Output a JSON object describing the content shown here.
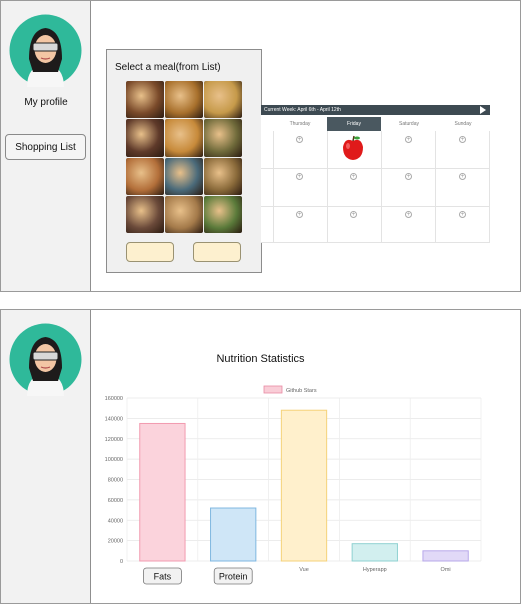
{
  "top": {
    "sidebar": {
      "profile_label": "My profile",
      "shopping_list_label": "Shopping List"
    },
    "dialog": {
      "title": "Select a meal(from List)",
      "tiles": [
        "#7a4a2a",
        "#a8702c",
        "#c69a4a",
        "#5f3a2a",
        "#c78a3a",
        "#6f6a3a",
        "#b36f3a",
        "#4a6a7a",
        "#8a6a3a",
        "#6b4a3a",
        "#a47a4a",
        "#5a7a3a"
      ]
    },
    "calendar": {
      "header": "Current Week: April 6th - April 12th",
      "days": [
        "Thursday",
        "Friday",
        "Saturday",
        "Sunday"
      ],
      "active_day": "Friday"
    }
  },
  "bottom": {
    "chart_title": "Nutrition Statistics",
    "chart_data": {
      "type": "bar",
      "title": "Nutrition Statistics",
      "categories": [
        "Fats",
        "Protein",
        "Vue",
        "Hyperapp",
        "Omi"
      ],
      "series": [
        {
          "name": "Github Stars",
          "values": [
            135000,
            52000,
            148000,
            17000,
            10000
          ]
        }
      ],
      "yticks": [
        "160000",
        "140000",
        "120000",
        "100000",
        "80000",
        "60000",
        "40000",
        "20000",
        "0"
      ],
      "ylim": [
        0,
        160000
      ],
      "colors": [
        "#fbd3dc",
        "#cfe6f7",
        "#fff0cc",
        "#d2efef",
        "#e1d9f7"
      ],
      "borders": [
        "#f29bb0",
        "#7fb7e0",
        "#f5d27a",
        "#8fd1d1",
        "#b7a8ea"
      ],
      "legend_color": "#f9cdd7"
    }
  }
}
